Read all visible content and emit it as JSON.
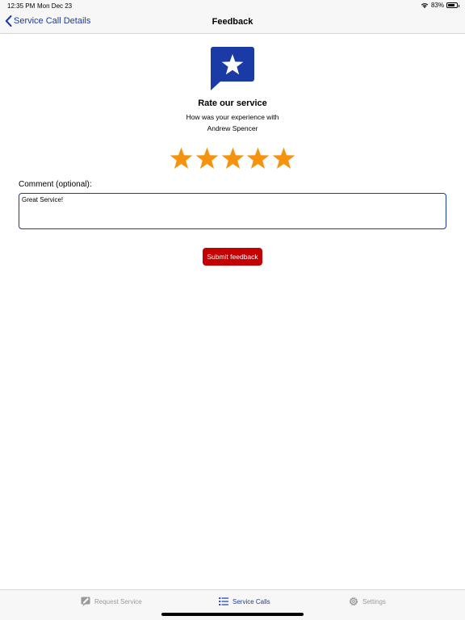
{
  "status_bar": {
    "time": "12:35 PM",
    "date": "Mon Dec 23",
    "battery_percent": "83%",
    "battery_level": 0.83
  },
  "nav": {
    "back_label": "Service Call Details",
    "title": "Feedback"
  },
  "feedback": {
    "heading": "Rate our service",
    "experience_line_1": "How was your experience with",
    "experience_line_2": "Andrew Spencer",
    "rating": 5,
    "max_rating": 5,
    "comment_label": "Comment (optional):",
    "comment_value": "Great Service!",
    "submit_label": "Submit feedback"
  },
  "tabs": [
    {
      "label": "Request Service",
      "icon": "request-service-icon",
      "active": false
    },
    {
      "label": "Service Calls",
      "icon": "list-icon",
      "active": true
    },
    {
      "label": "Settings",
      "icon": "gear-icon",
      "active": false
    }
  ],
  "colors": {
    "brand_blue": "#1a3aa5",
    "star_orange": "#f5930f",
    "submit_red": "#c40000",
    "inactive_gray": "#9a9a9a"
  }
}
